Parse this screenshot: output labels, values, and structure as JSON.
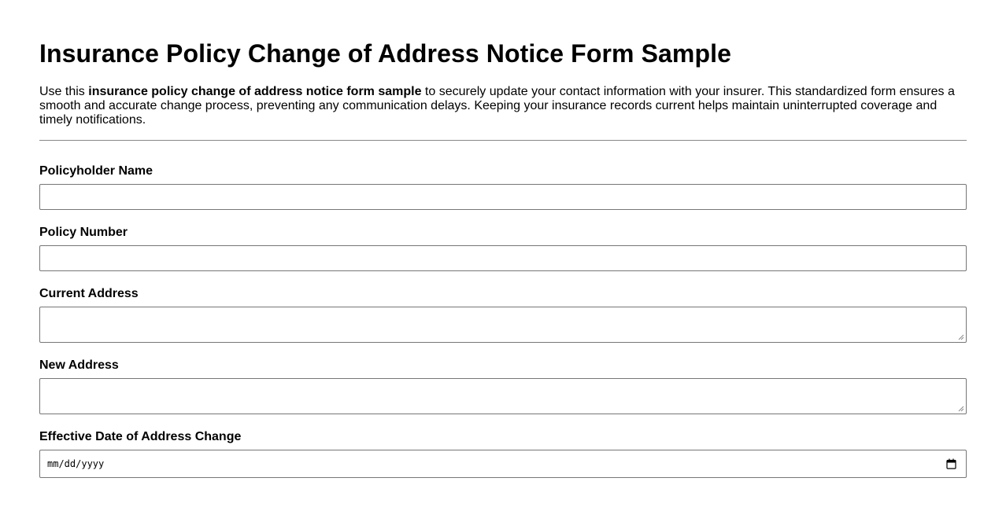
{
  "title": "Insurance Policy Change of Address Notice Form Sample",
  "intro": {
    "prefix": "Use this ",
    "bold": "insurance policy change of address notice form sample",
    "suffix": " to securely update your contact information with your insurer. This standardized form ensures a smooth and accurate change process, preventing any communication delays. Keeping your insurance records current helps maintain uninterrupted coverage and timely notifications."
  },
  "form": {
    "policyholder_name": {
      "label": "Policyholder Name",
      "value": ""
    },
    "policy_number": {
      "label": "Policy Number",
      "value": ""
    },
    "current_address": {
      "label": "Current Address",
      "value": ""
    },
    "new_address": {
      "label": "New Address",
      "value": ""
    },
    "effective_date": {
      "label": "Effective Date of Address Change",
      "placeholder": "mm/dd/yyyy",
      "icon": "calendar-icon"
    }
  }
}
